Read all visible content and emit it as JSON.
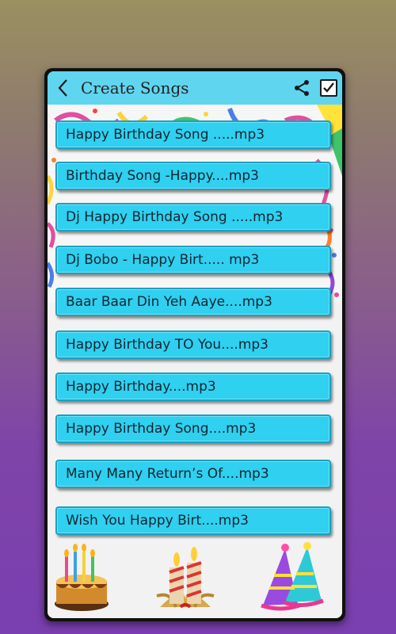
{
  "header": {
    "title": "Create Songs",
    "back_icon": "chevron-left-icon",
    "share_icon": "share-icon",
    "select_icon": "checkbox-checked-icon"
  },
  "songs": [
    "Happy Birthday Song .....mp3",
    "Birthday Song -Happy....mp3",
    "Dj Happy Birthday Song .....mp3",
    "Dj Bobo - Happy Birt..... mp3",
    "Baar Baar Din Yeh Aaye....mp3",
    "Happy Birthday TO You....mp3",
    " Happy Birthday....mp3",
    " Happy Birthday Song....mp3",
    "Many Many Return’s Of....mp3",
    "Wish You Happy Birt....mp3"
  ],
  "footer": {
    "items": [
      "birthday-cake-icon",
      "candles-icon",
      "party-hats-icon"
    ]
  },
  "colors": {
    "header_bg": "#5fd5f0",
    "song_bg": "#2fd0f0",
    "frame": "#101010"
  }
}
